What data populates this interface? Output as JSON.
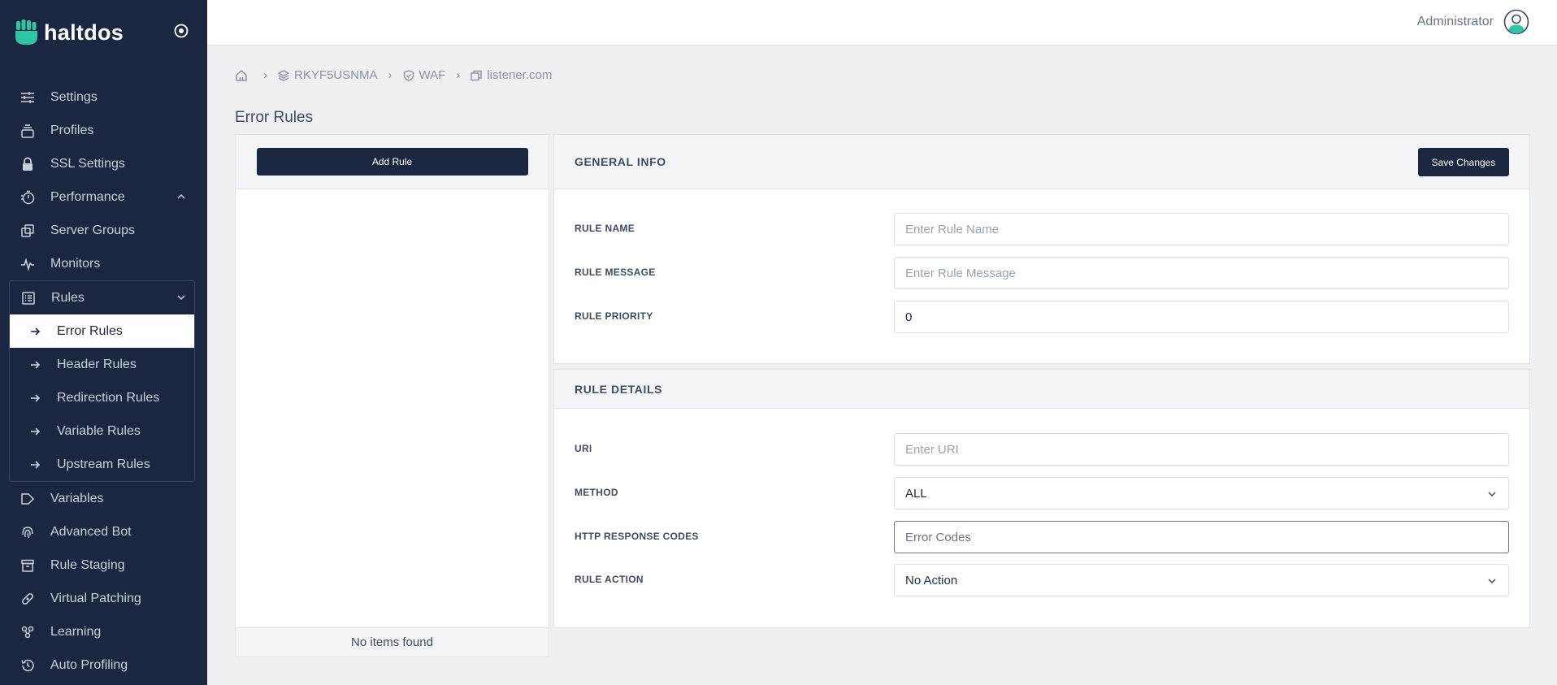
{
  "app": {
    "logo_text": "haltdos",
    "user_name": "Administrator"
  },
  "sidebar": {
    "items": [
      {
        "label": "Settings",
        "icon": "sliders-icon"
      },
      {
        "label": "Profiles",
        "icon": "stack-icon"
      },
      {
        "label": "SSL Settings",
        "icon": "lock-icon"
      },
      {
        "label": "Performance",
        "icon": "speedometer-icon"
      },
      {
        "label": "Server Groups",
        "icon": "copy-icon"
      },
      {
        "label": "Monitors",
        "icon": "pulse-icon"
      },
      {
        "label": "Rules",
        "icon": "list-icon"
      },
      {
        "label": "Variables",
        "icon": "tag-icon"
      },
      {
        "label": "Advanced Bot",
        "icon": "fingerprint-icon"
      },
      {
        "label": "Rule Staging",
        "icon": "archive-icon"
      },
      {
        "label": "Virtual Patching",
        "icon": "bandage-icon"
      },
      {
        "label": "Learning",
        "icon": "nodes-icon"
      },
      {
        "label": "Auto Profiling",
        "icon": "history-icon"
      }
    ],
    "rules_sub": [
      {
        "label": "Error Rules",
        "active": true
      },
      {
        "label": "Header Rules"
      },
      {
        "label": "Redirection Rules"
      },
      {
        "label": "Variable Rules"
      },
      {
        "label": "Upstream Rules"
      }
    ]
  },
  "breadcrumb": [
    "RKYF5USNMA",
    "WAF",
    "listener.com"
  ],
  "page_title": "Error Rules",
  "left_panel": {
    "add_button": "Add Rule",
    "empty_text": "No items found"
  },
  "general_info": {
    "title": "GENERAL INFO",
    "save_button": "Save Changes",
    "rule_name_label": "RULE NAME",
    "rule_name_placeholder": "Enter Rule Name",
    "rule_message_label": "RULE MESSAGE",
    "rule_message_placeholder": "Enter Rule Message",
    "rule_priority_label": "RULE PRIORITY",
    "rule_priority_value": "0"
  },
  "rule_details": {
    "title": "RULE DETAILS",
    "uri_label": "URI",
    "uri_placeholder": "Enter URI",
    "method_label": "METHOD",
    "method_value": "ALL",
    "codes_label": "HTTP RESPONSE CODES",
    "codes_placeholder": "Error Codes",
    "action_label": "RULE ACTION",
    "action_value": "No Action"
  },
  "colors": {
    "sidebar_bg": "#1b2740",
    "brand_accent": "#2ec4a6",
    "button_dark": "#1b2740",
    "page_bg": "#eef0f2"
  }
}
